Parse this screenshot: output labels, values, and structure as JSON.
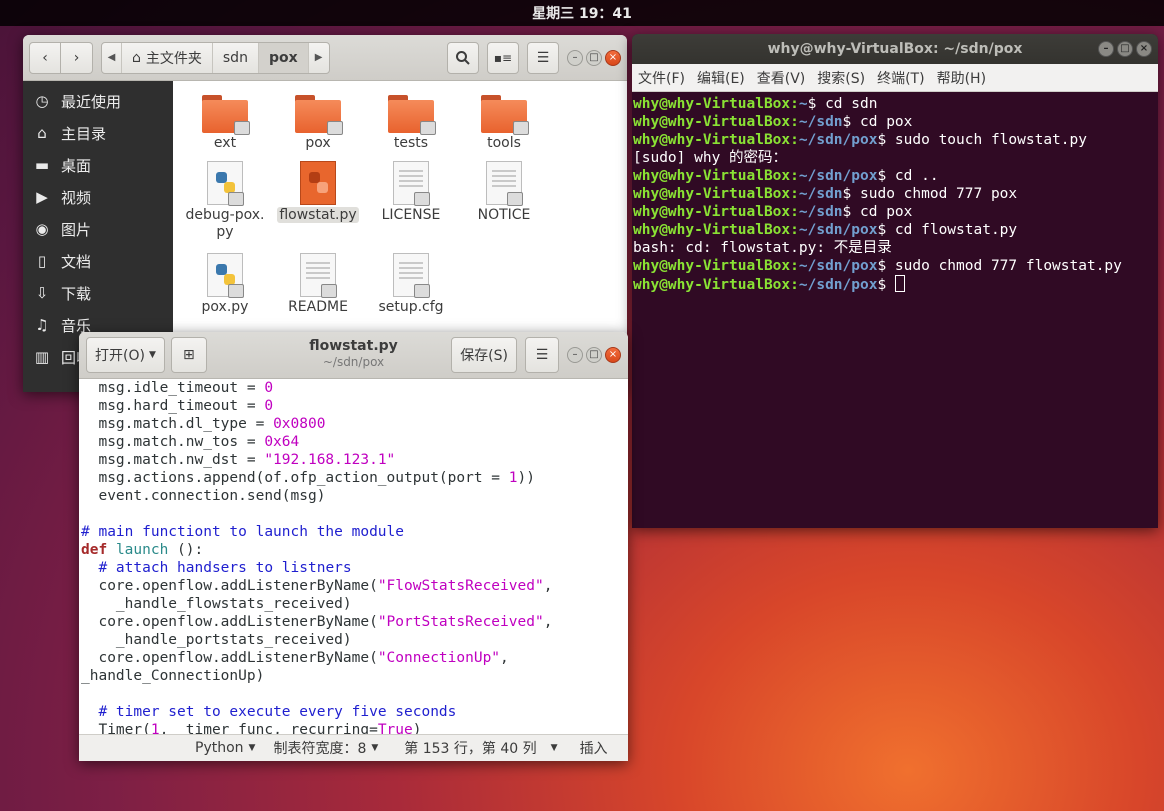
{
  "topbar": {
    "clock": "星期三 19：41"
  },
  "files": {
    "path": [
      "主文件夹",
      "sdn",
      "pox"
    ],
    "sidebar": [
      "最近使用",
      "主目录",
      "桌面",
      "视频",
      "图片",
      "文档",
      "下载",
      "音乐",
      "回收站"
    ],
    "items": [
      {
        "name": "ext",
        "type": "folder"
      },
      {
        "name": "pox",
        "type": "folder"
      },
      {
        "name": "tests",
        "type": "folder"
      },
      {
        "name": "tools",
        "type": "folder"
      },
      {
        "name": "debug-pox.\npy",
        "type": "python-exec"
      },
      {
        "name": "flowstat.py",
        "type": "python-new"
      },
      {
        "name": "LICENSE",
        "type": "text"
      },
      {
        "name": "NOTICE",
        "type": "text"
      },
      {
        "name": "pox.py",
        "type": "python"
      },
      {
        "name": "README",
        "type": "text"
      },
      {
        "name": "setup.cfg",
        "type": "text"
      }
    ]
  },
  "editor": {
    "open_label": "打开(O)",
    "save_label": "保存(S)",
    "title": "flowstat.py",
    "subtitle": "~/sdn/pox",
    "status": {
      "language": "Python",
      "tab_width": "制表符宽度：8",
      "position": "第 153 行，第 40 列",
      "mode": "插入"
    },
    "lines": [
      "  msg.idle_timeout = 0",
      "  msg.hard_timeout = 0",
      "  msg.match.dl_type = 0x0800",
      "  msg.match.nw_tos = 0x64",
      "  msg.match.nw_dst = \"192.168.123.1\"",
      "  msg.actions.append(of.ofp_action_output(port = 1))",
      "  event.connection.send(msg)",
      "",
      "# main functiont to launch the module",
      "def launch ():",
      "  # attach handsers to listners",
      "  core.openflow.addListenerByName(\"FlowStatsReceived\",",
      "    _handle_flowstats_received)",
      "  core.openflow.addListenerByName(\"PortStatsReceived\",",
      "    _handle_portstats_received)",
      "  core.openflow.addListenerByName(\"ConnectionUp\",",
      "_handle_ConnectionUp)",
      "",
      "  # timer set to execute every five seconds",
      "  Timer(1, _timer_func, recurring=True)"
    ]
  },
  "terminal": {
    "title": "why@why-VirtualBox: ~/sdn/pox",
    "menu": [
      "文件(F)",
      "编辑(E)",
      "查看(V)",
      "搜索(S)",
      "终端(T)",
      "帮助(H)"
    ],
    "lines": [
      {
        "user": "why@why-VirtualBox",
        "path": "~",
        "cmd": "cd sdn"
      },
      {
        "user": "why@why-VirtualBox",
        "path": "~/sdn",
        "cmd": "cd pox"
      },
      {
        "user": "why@why-VirtualBox",
        "path": "~/sdn/pox",
        "cmd": "sudo touch flowstat.py"
      },
      {
        "output": "[sudo] why 的密码："
      },
      {
        "user": "why@why-VirtualBox",
        "path": "~/sdn/pox",
        "cmd": "cd .."
      },
      {
        "user": "why@why-VirtualBox",
        "path": "~/sdn",
        "cmd": "sudo chmod 777 pox"
      },
      {
        "user": "why@why-VirtualBox",
        "path": "~/sdn",
        "cmd": "cd pox"
      },
      {
        "user": "why@why-VirtualBox",
        "path": "~/sdn/pox",
        "cmd": "cd flowstat.py"
      },
      {
        "output": "bash: cd: flowstat.py: 不是目录"
      },
      {
        "user": "why@why-VirtualBox",
        "path": "~/sdn/pox",
        "cmd": "sudo chmod 777 flowstat.py"
      },
      {
        "user": "why@why-VirtualBox",
        "path": "~/sdn/pox",
        "cmd": "",
        "cursor": true
      }
    ]
  }
}
